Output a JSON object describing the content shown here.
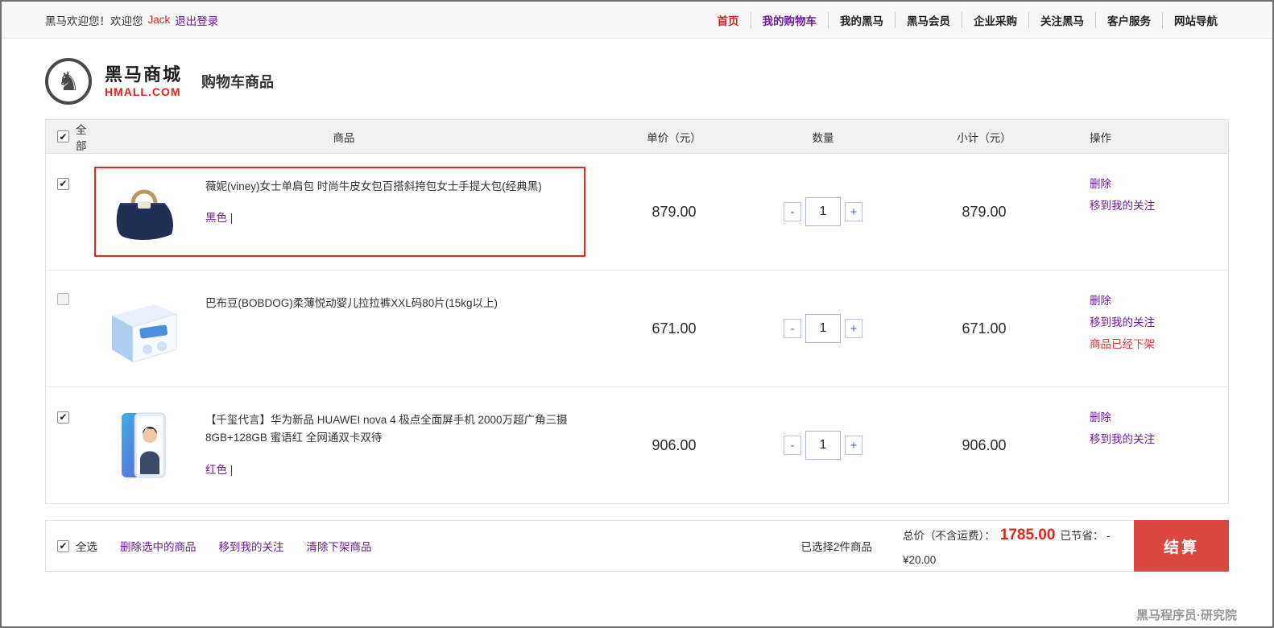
{
  "topbar": {
    "welcome_prefix": "黑马欢迎您！欢迎您",
    "username": "Jack",
    "logout": "退出登录",
    "nav": [
      {
        "label": "首页"
      },
      {
        "label": "我的购物车"
      },
      {
        "label": "我的黑马"
      },
      {
        "label": "黑马会员"
      },
      {
        "label": "企业采购"
      },
      {
        "label": "关注黑马"
      },
      {
        "label": "客户服务"
      },
      {
        "label": "网站导航"
      }
    ]
  },
  "header": {
    "brand_name": "黑马商城",
    "brand_domain": "HMALL.COM",
    "page_title": "购物车商品"
  },
  "table": {
    "columns": {
      "select_all": "全部",
      "product": "商品",
      "unit_price": "单价（元）",
      "quantity": "数量",
      "subtotal": "小计（元）",
      "actions": "操作"
    }
  },
  "quantity_controls": {
    "minus": "-",
    "plus": "+"
  },
  "cart_items": [
    {
      "checked": true,
      "selected_highlight": true,
      "title": "薇妮(viney)女士单肩包 时尚牛皮女包百搭斜挎包女士手提大包(经典黑)",
      "variant": "黑色 |",
      "unit_price": "879.00",
      "quantity": "1",
      "subtotal": "879.00",
      "actions": [
        "删除",
        "移到我的关注"
      ],
      "off_shelf_note": "",
      "image_kind": "handbag"
    },
    {
      "checked": false,
      "selected_highlight": false,
      "title": "巴布豆(BOBDOG)柔薄悦动婴儿拉拉裤XXL码80片(15kg以上)",
      "variant": "",
      "unit_price": "671.00",
      "quantity": "1",
      "subtotal": "671.00",
      "actions": [
        "删除",
        "移到我的关注"
      ],
      "off_shelf_note": "商品已经下架",
      "image_kind": "diapers"
    },
    {
      "checked": true,
      "selected_highlight": false,
      "title": "【千玺代言】华为新品 HUAWEI nova 4 极点全面屏手机 2000万超广角三摄 8GB+128GB 蜜语红 全网通双卡双待",
      "variant": "红色 |",
      "unit_price": "906.00",
      "quantity": "1",
      "subtotal": "906.00",
      "actions": [
        "删除",
        "移到我的关注"
      ],
      "off_shelf_note": "",
      "image_kind": "phone"
    }
  ],
  "footer": {
    "select_all": "全选",
    "select_all_checked": true,
    "bulk_actions": [
      "删除选中的商品",
      "移到我的关注",
      "清除下架商品"
    ],
    "selected_summary": "已选择2件商品",
    "total_label": "总价（不含运费）：",
    "total_value": "1785.00",
    "savings_label": "已节省：",
    "savings_value": "-¥20.00",
    "checkout": "结算"
  },
  "watermark": "黑马程序员·研究院",
  "colors": {
    "accent_red": "#e1251b",
    "checkout_red": "#dc4840",
    "link_purple": "#6a1b9a",
    "nav_home_red": "#c62828",
    "off_shelf_red": "#e4393c",
    "highlight_border_red": "#e02a22"
  }
}
